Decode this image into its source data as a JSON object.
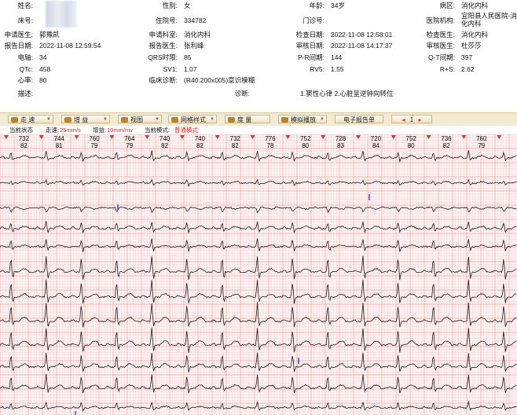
{
  "patient": {
    "name_label": "姓名:",
    "gender_label": "性别:",
    "gender": "女",
    "age_label": "年龄:",
    "age": "34岁",
    "ward_label": "病区:",
    "ward": "消化内科",
    "bed_label": "床号:",
    "bed": "",
    "inpatient_no_label": "住院号:",
    "inpatient_no": "334782",
    "outpatient_no_label": "门诊号:",
    "outpatient_no": "",
    "hospital_label": "医院机构:",
    "hospital": "宜阳县人民医院-消化内科",
    "apply_doctor_label": "申请医生:",
    "apply_doctor": "郭豫凯",
    "apply_dept_label": "申请科室:",
    "apply_dept": "消化内科",
    "exam_date_label": "检查日期:",
    "exam_date": "2022-11-08 12:58:01",
    "exam_doctor_label": "检查医生:",
    "exam_doctor": "消化内科",
    "report_date_label": "报告日期:",
    "report_date": "2022-11-08 12:59:54",
    "report_doctor_label": "报告医生:",
    "report_doctor": "张利峰",
    "audit_date_label": "审核日期:",
    "audit_date": "2022-11-08 14:17:37",
    "audit_doctor_label": "审核医生:",
    "audit_doctor": "杜莎莎",
    "axis_label": "电轴:",
    "axis": "34",
    "qrs_label": "QRS时限:",
    "qrs": "85",
    "pr_label": "P-R间期:",
    "pr": "144",
    "qt_label": "Q-T间期:",
    "qt": "397",
    "qtc_label": "QTc:",
    "qtc": "458",
    "sv1_label": "SV1:",
    "sv1": "1.07",
    "rv5_label": "RV5:",
    "rv5": "1.55",
    "rs_label": "R+S:",
    "rs": "2.62",
    "hr_label": "心率:",
    "hr": "80",
    "clinical_dx_label": "临床诊断:",
    "clinical_dx": "(R40.200x005)意识模糊",
    "desc_label": "描述:",
    "desc": "",
    "diagnosis_label": "诊断:",
    "diagnosis": "1.窦性心律  2.心脏呈逆钟向转位"
  },
  "toolbar": {
    "speed": "走 速",
    "gain": "增 益",
    "view": "视图",
    "grid": "网格样式",
    "measure": "度 量",
    "simulate": "模拟播放",
    "report": "电子报告单",
    "page": "1"
  },
  "status": {
    "state_label": "当前状态",
    "speed_label": "走速:",
    "speed_value": "25mm/s",
    "gain_label": "增益:",
    "gain_value": "10mm/mv",
    "mode_label": "当前模式:",
    "mode_value": "普通模式"
  },
  "colors": {
    "grid_minor": "#f6c9c9",
    "grid_major": "#eca2a2",
    "trace": "#1a1a1a",
    "pacer_marker": "#2a3ad6",
    "marker_triangle": "#d0353a",
    "toolbar_bg": "#f3ead4"
  },
  "rr_intervals": [
    {
      "ms": "732",
      "bpm": "82"
    },
    {
      "ms": "744",
      "bpm": "81"
    },
    {
      "ms": "760",
      "bpm": "79"
    },
    {
      "ms": "764",
      "bpm": "79"
    },
    {
      "ms": "740",
      "bpm": "82"
    },
    {
      "ms": "740",
      "bpm": "82"
    },
    {
      "ms": "732",
      "bpm": "82"
    },
    {
      "ms": "776",
      "bpm": "78"
    },
    {
      "ms": "752",
      "bpm": "80"
    },
    {
      "ms": "728",
      "bpm": "83"
    },
    {
      "ms": "720",
      "bpm": "84"
    },
    {
      "ms": "752",
      "bpm": "80"
    },
    {
      "ms": "736",
      "bpm": "82"
    },
    {
      "ms": "760",
      "bpm": "79"
    }
  ]
}
